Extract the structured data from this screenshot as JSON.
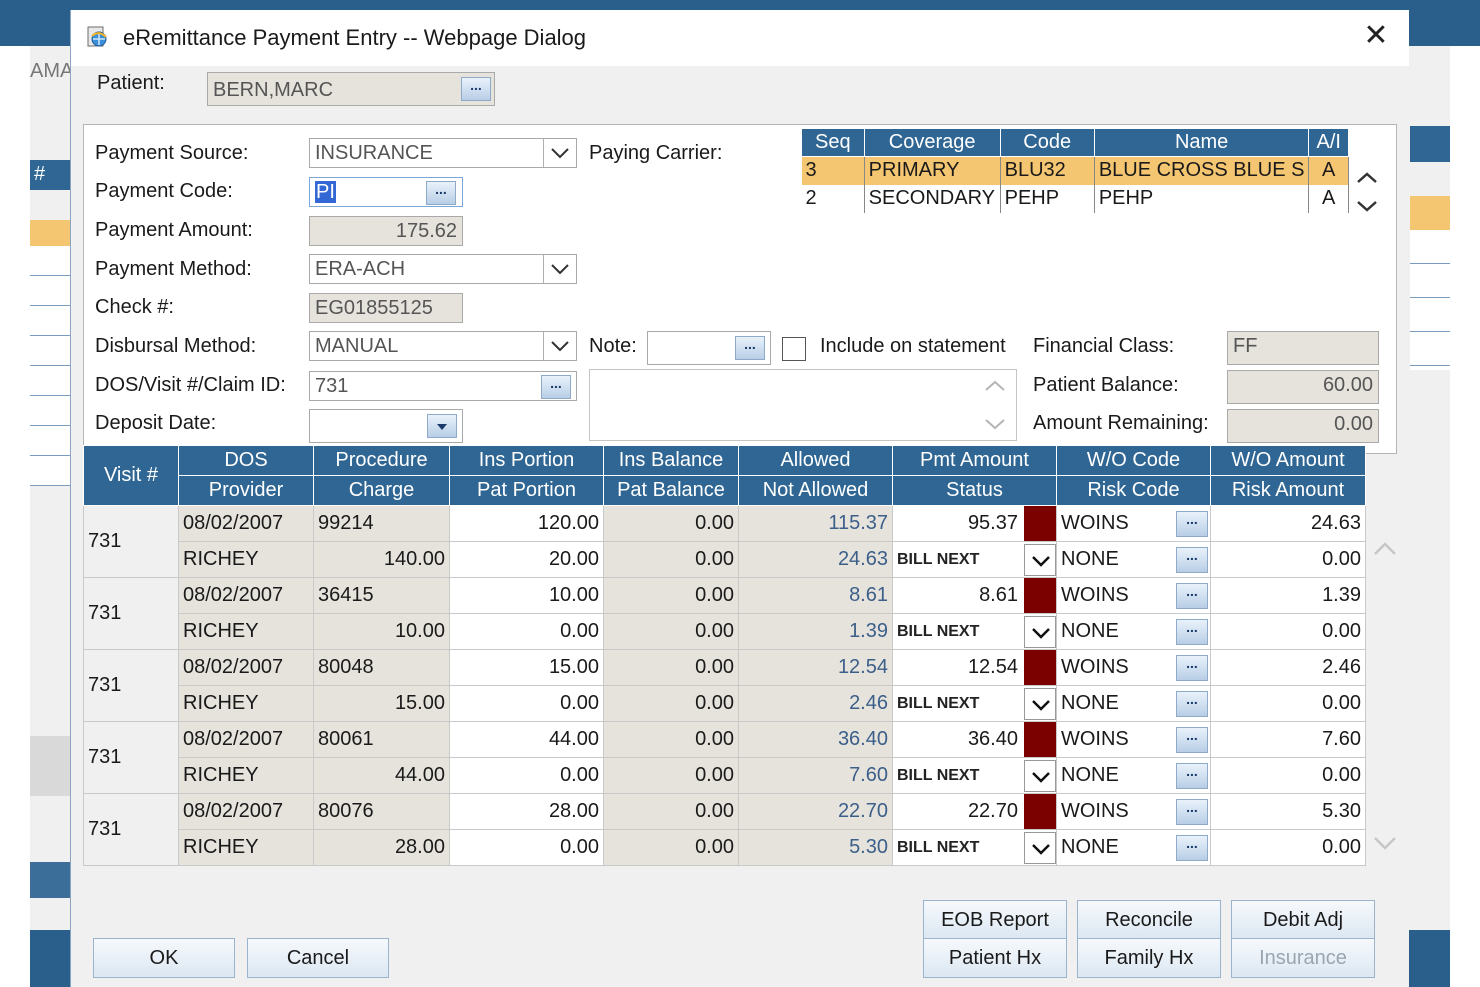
{
  "background": {
    "left_fragment": "AMA",
    "hash": "#"
  },
  "window": {
    "title": "eRemittance Payment Entry -- Webpage Dialog",
    "close": "✕"
  },
  "patient": {
    "label": "Patient:",
    "value": "BERN,MARC"
  },
  "form": {
    "payment_source": {
      "label": "Payment Source:",
      "value": "INSURANCE"
    },
    "payment_code": {
      "label": "Payment Code:",
      "value": "PI"
    },
    "payment_amount": {
      "label": "Payment Amount:",
      "value": "175.62"
    },
    "payment_method": {
      "label": "Payment Method:",
      "value": "ERA-ACH"
    },
    "check": {
      "label": "Check #:",
      "value": "EG01855125"
    },
    "disbursal_method": {
      "label": "Disbursal Method:",
      "value": "MANUAL"
    },
    "dos_visit": {
      "label": "DOS/Visit #/Claim ID:",
      "value": "731"
    },
    "deposit_date": {
      "label": "Deposit Date:",
      "value": ""
    },
    "paying_carrier": {
      "label": "Paying Carrier:"
    },
    "note": {
      "label": "Note:",
      "value": ""
    },
    "include_statement": {
      "label": "Include on statement",
      "checked": false
    },
    "financial_class": {
      "label": "Financial Class:",
      "value": "FF"
    },
    "patient_balance": {
      "label": "Patient Balance:",
      "value": "60.00"
    },
    "amount_remaining": {
      "label": "Amount Remaining:",
      "value": "0.00"
    }
  },
  "carriers": {
    "headers": [
      "Seq",
      "Coverage",
      "Code",
      "Name",
      "A/I"
    ],
    "rows": [
      {
        "seq": "3",
        "coverage": "PRIMARY",
        "code": "BLU32",
        "name": "BLUE CROSS BLUE S",
        "ai": "A"
      },
      {
        "seq": "2",
        "coverage": "SECONDARY",
        "code": "PEHP",
        "name": "PEHP",
        "ai": "A"
      }
    ]
  },
  "grid": {
    "header_top": [
      "Visit #",
      "DOS",
      "Procedure",
      "Ins Portion",
      "Ins Balance",
      "Allowed",
      "Pmt Amount",
      "W/O Code",
      "W/O Amount"
    ],
    "header_bottom": [
      "Provider",
      "Charge",
      "Pat Portion",
      "Pat Balance",
      "Not Allowed",
      "Status",
      "Risk Code",
      "Risk Amount"
    ],
    "rows": [
      {
        "visit": "731",
        "dos": "08/02/2007",
        "procedure": "99214",
        "ins_portion": "120.00",
        "ins_balance": "0.00",
        "allowed": "115.37",
        "pmt_amount": "95.37",
        "wo_code": "WOINS",
        "wo_amount": "24.63",
        "provider": "RICHEY",
        "charge": "140.00",
        "pat_portion": "20.00",
        "pat_balance": "0.00",
        "not_allowed": "24.63",
        "status": "BILL NEXT",
        "risk_code": "NONE",
        "risk_amount": "0.00"
      },
      {
        "visit": "731",
        "dos": "08/02/2007",
        "procedure": "36415",
        "ins_portion": "10.00",
        "ins_balance": "0.00",
        "allowed": "8.61",
        "pmt_amount": "8.61",
        "wo_code": "WOINS",
        "wo_amount": "1.39",
        "provider": "RICHEY",
        "charge": "10.00",
        "pat_portion": "0.00",
        "pat_balance": "0.00",
        "not_allowed": "1.39",
        "status": "BILL NEXT",
        "risk_code": "NONE",
        "risk_amount": "0.00"
      },
      {
        "visit": "731",
        "dos": "08/02/2007",
        "procedure": "80048",
        "ins_portion": "15.00",
        "ins_balance": "0.00",
        "allowed": "12.54",
        "pmt_amount": "12.54",
        "wo_code": "WOINS",
        "wo_amount": "2.46",
        "provider": "RICHEY",
        "charge": "15.00",
        "pat_portion": "0.00",
        "pat_balance": "0.00",
        "not_allowed": "2.46",
        "status": "BILL NEXT",
        "risk_code": "NONE",
        "risk_amount": "0.00"
      },
      {
        "visit": "731",
        "dos": "08/02/2007",
        "procedure": "80061",
        "ins_portion": "44.00",
        "ins_balance": "0.00",
        "allowed": "36.40",
        "pmt_amount": "36.40",
        "wo_code": "WOINS",
        "wo_amount": "7.60",
        "provider": "RICHEY",
        "charge": "44.00",
        "pat_portion": "0.00",
        "pat_balance": "0.00",
        "not_allowed": "7.60",
        "status": "BILL NEXT",
        "risk_code": "NONE",
        "risk_amount": "0.00"
      },
      {
        "visit": "731",
        "dos": "08/02/2007",
        "procedure": "80076",
        "ins_portion": "28.00",
        "ins_balance": "0.00",
        "allowed": "22.70",
        "pmt_amount": "22.70",
        "wo_code": "WOINS",
        "wo_amount": "5.30",
        "provider": "RICHEY",
        "charge": "28.00",
        "pat_portion": "0.00",
        "pat_balance": "0.00",
        "not_allowed": "5.30",
        "status": "BILL NEXT",
        "risk_code": "NONE",
        "risk_amount": "0.00"
      }
    ]
  },
  "buttons": {
    "ok": "OK",
    "cancel": "Cancel",
    "eob_report": "EOB Report",
    "reconcile": "Reconcile",
    "debit_adj": "Debit Adj",
    "patient_hx": "Patient Hx",
    "family_hx": "Family Hx",
    "insurance": "Insurance",
    "ellipsis": "..."
  },
  "colors": {
    "header_blue": "#2f6693",
    "selected_row": "#f5c671",
    "marker_red": "#7b0000"
  }
}
